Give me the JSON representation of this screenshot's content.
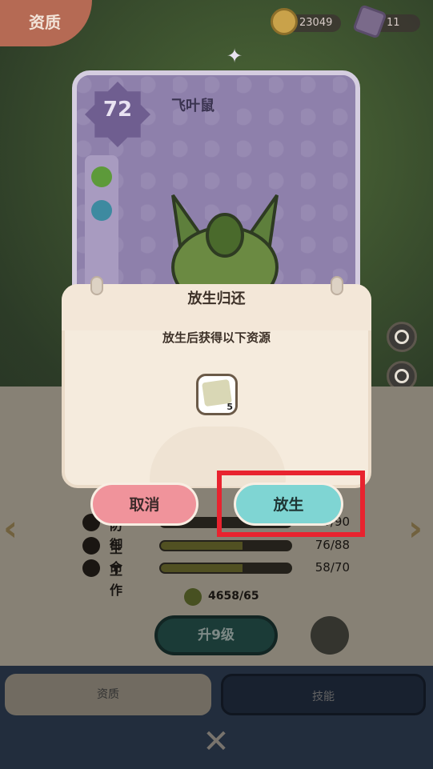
{
  "header": {
    "tab_label": "资质"
  },
  "resources": {
    "gold": "23049",
    "crystal": "11"
  },
  "pet": {
    "level": "72",
    "name": "飞叶鼠"
  },
  "stats": [
    {
      "label": "防御",
      "value": "?/90",
      "progress": 0.0
    },
    {
      "label": "生命",
      "value": "76/88",
      "progress": 0.63
    },
    {
      "label": "工作",
      "value": "58/70",
      "progress": 0.63
    }
  ],
  "exp": {
    "value": "4658/65"
  },
  "level_up": {
    "label": "升9级"
  },
  "tabs": [
    {
      "label": "资质"
    },
    {
      "label": "技能"
    }
  ],
  "dialog": {
    "title": "放生归还",
    "subtitle": "放生后获得以下资源",
    "reward_qty": "5",
    "cancel_label": "取消",
    "confirm_label": "放生"
  },
  "icons": [
    "gold-coin-icon",
    "crystal-icon",
    "sparkle-icon",
    "leaf-icon",
    "link-icon",
    "lock-icon",
    "search-icon",
    "pet-face-icon",
    "left-arrow-icon",
    "right-arrow-icon",
    "close-icon",
    "frog-icon",
    "evolve-icon"
  ],
  "colors": {
    "highlight": "#e8232f",
    "cancel": "#f0939b",
    "confirm": "#7fd5d3"
  }
}
